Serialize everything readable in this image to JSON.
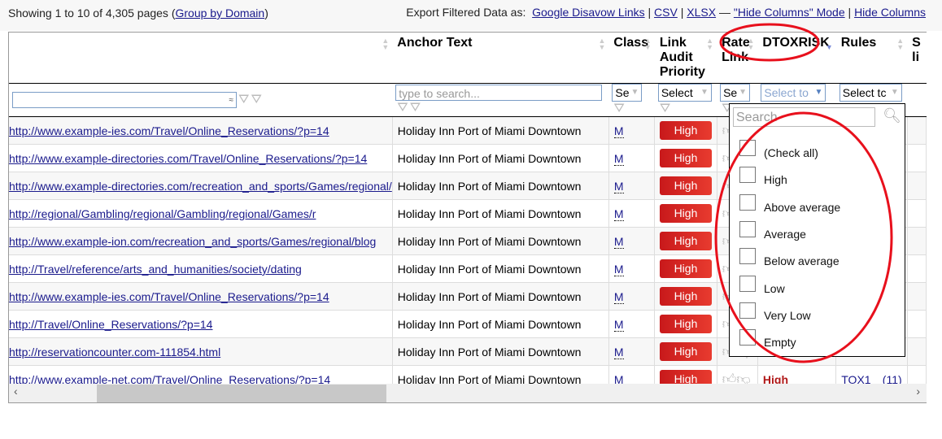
{
  "header": {
    "showing": "Showing 1 to 10 of 4,305 pages (",
    "group_by": "Group by Domain",
    "close_paren": ")",
    "export_label": "Export Filtered Data as:",
    "export_links": [
      "Google Disavow Links",
      "CSV",
      "XLSX"
    ],
    "dash": "—",
    "hide_mode": "\"Hide Columns\" Mode",
    "hide_columns": "Hide Columns"
  },
  "columns": [
    "",
    "Anchor Text",
    "Class",
    "Link Audit Priority",
    "Rate Link",
    "DTOXRISK",
    "Rules",
    "S li"
  ],
  "filters": {
    "anchor_placeholder": "type to search...",
    "class": "Se",
    "lap": "Select",
    "rate": "Se",
    "dtox": "Select to",
    "rules": "Select tc"
  },
  "rows": [
    {
      "url": "http://www.example-ies.com/Travel/Online_Reservations/?p=14",
      "anchor": "Holiday Inn Port of Miami Downtown",
      "class": "M",
      "priority": "High"
    },
    {
      "url": "http://www.example-directories.com/Travel/Online_Reservations/?p=14",
      "anchor": "Holiday Inn Port of Miami Downtown",
      "class": "M",
      "priority": "High"
    },
    {
      "url": "http://www.example-directories.com/recreation_and_sports/Games/regional/",
      "anchor": "Holiday Inn Port of Miami Downtown",
      "class": "M",
      "priority": "High"
    },
    {
      "url": "http://regional/Gambling/regional/Gambling/regional/Games/r",
      "anchor": "Holiday Inn Port of Miami Downtown",
      "class": "M",
      "priority": "High"
    },
    {
      "url": "http://www.example-ion.com/recreation_and_sports/Games/regional/blog",
      "anchor": "Holiday Inn Port of Miami Downtown",
      "class": "M",
      "priority": "High"
    },
    {
      "url": "http://Travel/reference/arts_and_humanities/society/dating",
      "anchor": "Holiday Inn Port of Miami Downtown",
      "class": "M",
      "priority": "High"
    },
    {
      "url": "http://www.example-ies.com/Travel/Online_Reservations/?p=14",
      "anchor": "Holiday Inn Port of Miami Downtown",
      "class": "M",
      "priority": "High"
    },
    {
      "url": "http://Travel/Online_Reservations/?p=14",
      "anchor": "Holiday Inn Port of Miami Downtown",
      "class": "M",
      "priority": "High"
    },
    {
      "url": "http://reservationcounter.com-111854.html",
      "anchor": "Holiday Inn Port of Miami Downtown",
      "class": "M",
      "priority": "High"
    },
    {
      "url": "http://www.example-net.com/Travel/Online_Reservations/?p=14",
      "anchor": "Holiday Inn Port of Miami Downtown",
      "class": "M",
      "priority": "High",
      "dtox": "High",
      "rule": "TOX1",
      "rule_count": "(11)"
    }
  ],
  "dropdown": {
    "search_placeholder": "Search",
    "options": [
      "(Check all)",
      "High",
      "Above average",
      "Average",
      "Below average",
      "Low",
      "Very Low",
      "Empty"
    ]
  },
  "colors": {
    "high_badge": "#d42220",
    "annotation": "#e8101c",
    "link": "#1a1a8c"
  }
}
